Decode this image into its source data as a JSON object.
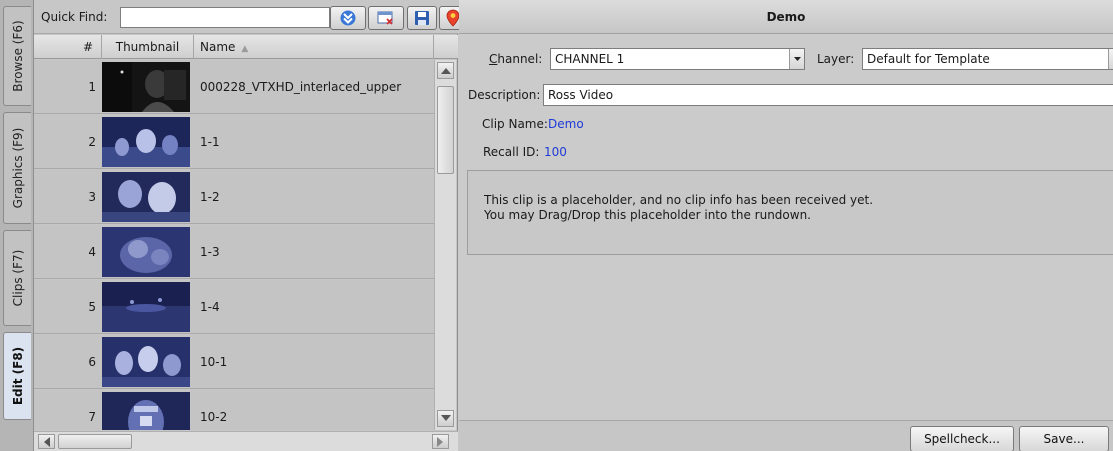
{
  "tabs": [
    {
      "label": "Browse (F6)",
      "active": false
    },
    {
      "label": "Graphics (F9)",
      "active": false
    },
    {
      "label": "Clips (F7)",
      "active": false
    },
    {
      "label": "Edit (F8)",
      "active": true
    }
  ],
  "quick_find": {
    "label": "Quick Find:",
    "value": "",
    "placeholder": ""
  },
  "toolbar": {
    "buttons": [
      {
        "name": "expand-icon"
      },
      {
        "name": "clear-filter-icon"
      },
      {
        "name": "save-icon"
      },
      {
        "name": "location-pin-icon"
      }
    ]
  },
  "table": {
    "columns": {
      "num": "#",
      "thumbnail": "Thumbnail",
      "name": "Name"
    },
    "rows": [
      {
        "num": "1",
        "name": "000228_VTXHD_interlaced_upper"
      },
      {
        "num": "2",
        "name": "1-1"
      },
      {
        "num": "3",
        "name": "1-2"
      },
      {
        "num": "4",
        "name": "1-3"
      },
      {
        "num": "5",
        "name": "1-4"
      },
      {
        "num": "6",
        "name": "10-1"
      },
      {
        "num": "7",
        "name": "10-2"
      }
    ]
  },
  "editor": {
    "title": "Demo",
    "channel_label_u": "C",
    "channel_label_rest": "hannel:",
    "channel_value": "CHANNEL 1",
    "layer_label": "Layer:",
    "layer_value": "Default for Template",
    "description_label": "Description:",
    "description_value": "Ross Video",
    "clip_name_label": "Clip Name:",
    "clip_name_value": "Demo",
    "recall_id_label": "Recall ID:",
    "recall_id_value": "100",
    "info_line1": "This clip is a placeholder, and no clip info has been received yet.",
    "info_line2": "You may Drag/Drop this placeholder into the rundown.",
    "spellcheck_label": "Spellcheck...",
    "save_label": "Save..."
  },
  "colors": {
    "accent_blue": "#1e3ad6",
    "active_tab": "#dce3f0"
  }
}
